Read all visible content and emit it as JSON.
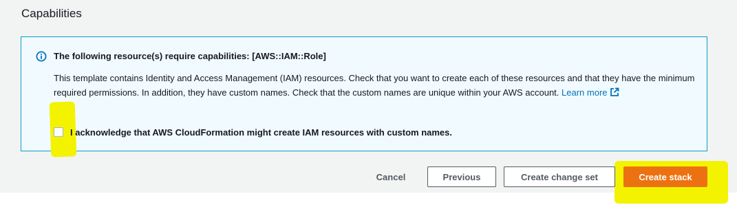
{
  "section": {
    "title": "Capabilities"
  },
  "info_alert": {
    "icon": "info-icon",
    "header": "The following resource(s) require capabilities: [AWS::IAM::Role]",
    "body": "This template contains Identity and Access Management (IAM) resources. Check that you want to create each of these resources and that they have the minimum required permissions. In addition, they have custom names. Check that the custom names are unique within your AWS account.",
    "learn_more": "Learn more",
    "acknowledge_label": "I acknowledge that AWS CloudFormation might create IAM resources with custom names.",
    "acknowledge_checked": false
  },
  "actions": {
    "cancel": "Cancel",
    "previous": "Previous",
    "create_change_set": "Create change set",
    "create_stack": "Create stack"
  },
  "colors": {
    "page_background": "#f2f3f3",
    "info_border": "#00a1c9",
    "info_background": "#f1faff",
    "link": "#0073bb",
    "primary": "#ec7211",
    "highlight": "#f3f300"
  }
}
